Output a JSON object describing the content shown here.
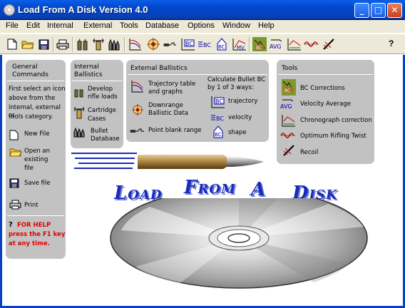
{
  "window": {
    "title": "Load From A Disk Version 4.0",
    "min_label": "_",
    "max_label": "□",
    "close_label": "✕"
  },
  "menu": [
    "File",
    "Edit",
    "Internal",
    "External",
    "Tools",
    "Database",
    "Options",
    "Window",
    "Help"
  ],
  "toolbar": {
    "help_label": "?"
  },
  "general": {
    "title_line1": "General",
    "title_line2": "Commands",
    "intro_line1": "First select an icon",
    "intro_line2": "above from the",
    "intro_line3": "internal, external or",
    "intro_line4": "tools category.",
    "new_file": "New File",
    "open_line1": "Open an",
    "open_line2": "existing",
    "open_line3": "file",
    "save_file": "Save file",
    "print": "Print",
    "help_q": "?",
    "help_line1": "FOR HELP",
    "help_line2": "press the F1 key",
    "help_line3": "at any time."
  },
  "internal": {
    "title_line1": "Internal",
    "title_line2": "Ballistics",
    "develop_line1": "Develop",
    "develop_line2": "rifle loads",
    "cartridge_line1": "Cartridge",
    "cartridge_line2": "Cases",
    "bullet_line1": "Bullet",
    "bullet_line2": "Database"
  },
  "external": {
    "title": "External Ballistics",
    "trajectory_line1": "Trajectory table",
    "trajectory_line2": "and graphs",
    "downrange_line1": "Downrange",
    "downrange_line2": "Ballistic Data",
    "pointblank": "Point blank range",
    "calc_line1": "Calculate Bullet BC",
    "calc_line2": "by 1 of 3 ways:",
    "bc_trajectory": "trajectory",
    "bc_velocity": "velocity",
    "bc_shape": "shape"
  },
  "tools": {
    "title": "Tools",
    "bc_corrections": "BC Corrections",
    "velocity_average": "Velocity Average",
    "chronograph": "Chronograph correction",
    "twist": "Optimum Rifling Twist",
    "recoil": "Recoil"
  },
  "logo": {
    "w1_first": "L",
    "w1_rest": "OAD",
    "w2_first": "F",
    "w2_rest": "ROM",
    "w3": "A",
    "w4_first": "D",
    "w4_rest": "ISK"
  },
  "icon_text": {
    "bc": "BC",
    "avg": "AVG",
    "mv": "MV"
  }
}
